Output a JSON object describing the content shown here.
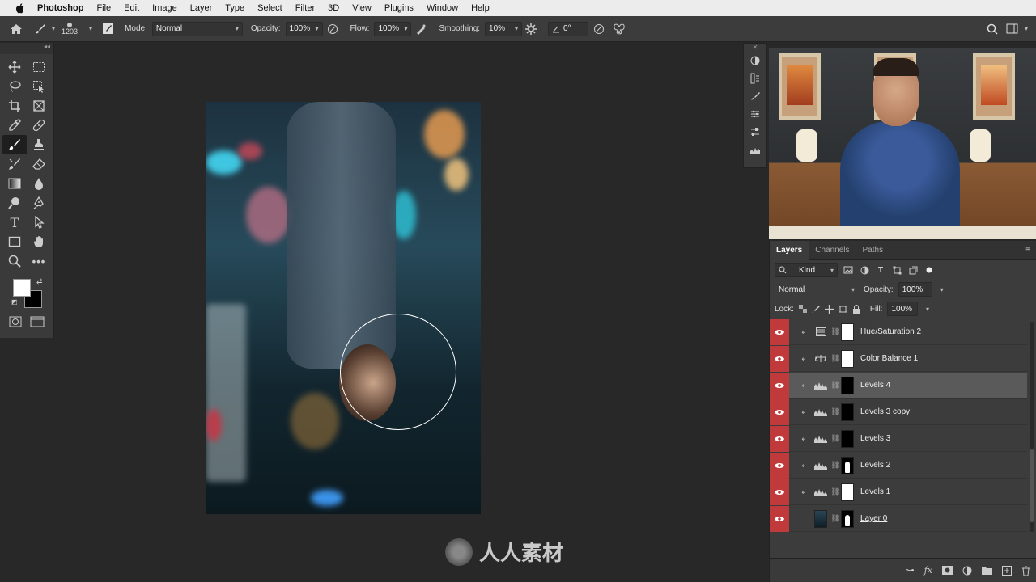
{
  "menubar": {
    "app": "Photoshop",
    "items": [
      "File",
      "Edit",
      "Image",
      "Layer",
      "Type",
      "Select",
      "Filter",
      "3D",
      "View",
      "Plugins",
      "Window",
      "Help"
    ]
  },
  "options": {
    "brush_size": "1203",
    "mode_label": "Mode:",
    "mode_value": "Normal",
    "opacity_label": "Opacity:",
    "opacity_value": "100%",
    "flow_label": "Flow:",
    "flow_value": "100%",
    "smoothing_label": "Smoothing:",
    "smoothing_value": "10%",
    "angle_value": "0°"
  },
  "layers_panel": {
    "tabs": [
      "Layers",
      "Channels",
      "Paths"
    ],
    "filter_kind": "Kind",
    "blend_mode": "Normal",
    "opacity_label": "Opacity:",
    "opacity_value": "100%",
    "lock_label": "Lock:",
    "fill_label": "Fill:",
    "fill_value": "100%",
    "layers": [
      {
        "name": "Hue/Saturation 2",
        "icon": "hue-saturation-icon",
        "mask": "white",
        "selected": false
      },
      {
        "name": "Color Balance 1",
        "icon": "color-balance-icon",
        "mask": "white",
        "selected": false
      },
      {
        "name": "Levels 4",
        "icon": "levels-icon",
        "mask": "black",
        "selected": true
      },
      {
        "name": "Levels 3 copy",
        "icon": "levels-icon",
        "mask": "black",
        "selected": false
      },
      {
        "name": "Levels 3",
        "icon": "levels-icon",
        "mask": "black",
        "selected": false
      },
      {
        "name": "Levels 2",
        "icon": "levels-icon",
        "mask": "silhouette",
        "selected": false
      },
      {
        "name": "Levels 1",
        "icon": "levels-icon",
        "mask": "white",
        "selected": false
      },
      {
        "name": "Layer 0",
        "icon": "photo-thumbnail",
        "mask": "silhouette",
        "selected": false
      }
    ]
  },
  "watermark": {
    "text": "人人素材"
  },
  "colors": {
    "eye_column": "#c0393b",
    "selected_layer": "#5a5a5a",
    "panel_bg": "#3c3c3c"
  }
}
